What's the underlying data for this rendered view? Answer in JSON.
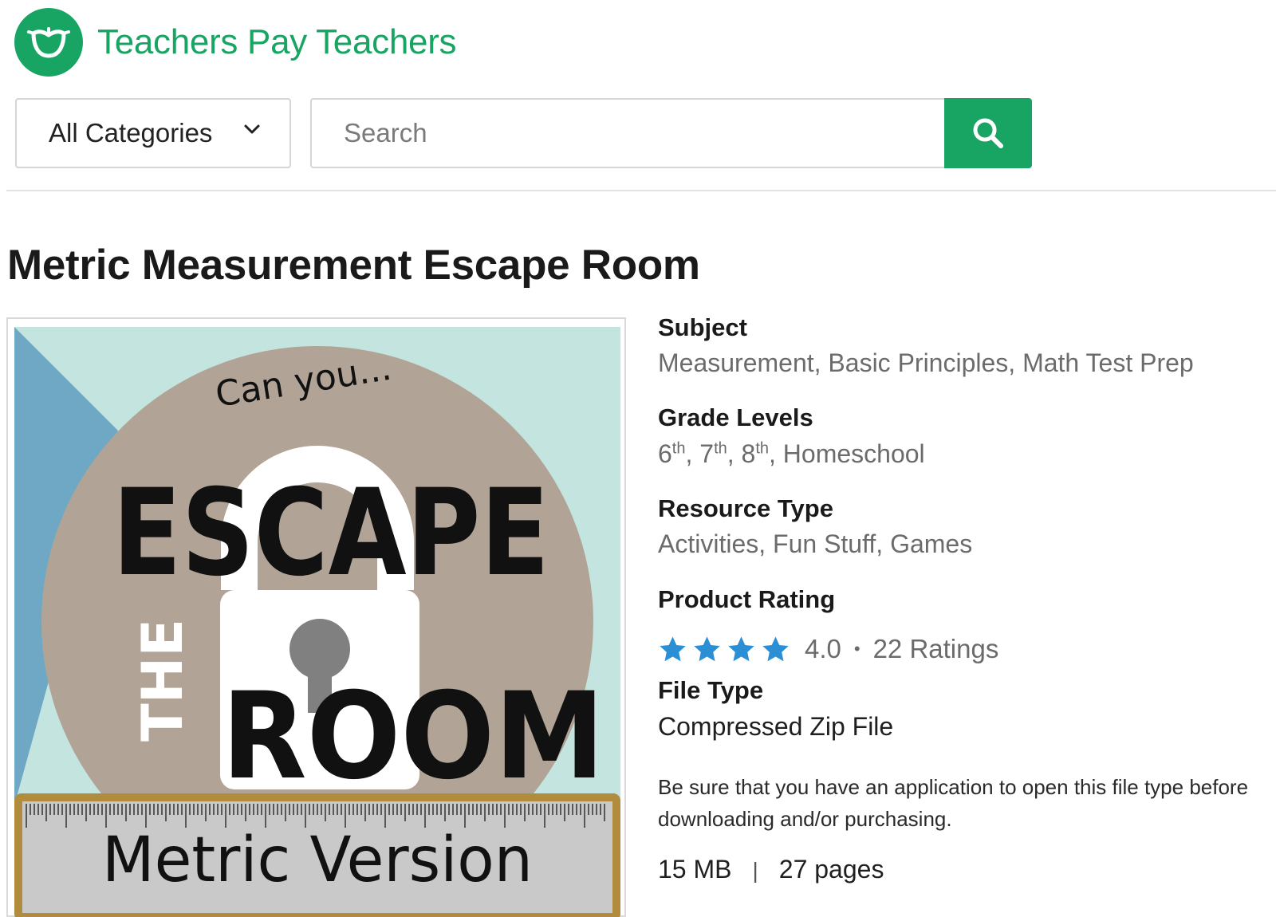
{
  "brand": {
    "name": "Teachers Pay Teachers",
    "color": "#18a564",
    "logo_icon": "apple-icon"
  },
  "search": {
    "category_label": "All Categories",
    "placeholder": "Search",
    "button_icon": "search-icon"
  },
  "product": {
    "title": "Metric Measurement Escape Room",
    "cover": {
      "line1": "Can you...",
      "line2": "ESCAPE",
      "line3": "THE",
      "line4": "ROOM",
      "line5": "Metric Version"
    },
    "subject": {
      "label": "Subject",
      "values": [
        "Measurement",
        "Basic Principles",
        "Math Test Prep"
      ]
    },
    "grades": {
      "label": "Grade Levels",
      "items": [
        {
          "num": "6",
          "suffix": "th"
        },
        {
          "num": "7",
          "suffix": "th"
        },
        {
          "num": "8",
          "suffix": "th"
        }
      ],
      "extra": "Homeschool"
    },
    "resource_type": {
      "label": "Resource Type",
      "values": [
        "Activities",
        "Fun Stuff",
        "Games"
      ]
    },
    "rating": {
      "label": "Product Rating",
      "value": "4.0",
      "stars": 4,
      "count_text": "22 Ratings",
      "star_color": "#2b8fd6"
    },
    "file_type": {
      "label": "File Type",
      "value": "Compressed Zip File",
      "note": "Be sure that you have an application to open this file type before downloading and/or purchasing."
    },
    "file_size": "15 MB",
    "pages": "27 pages"
  }
}
